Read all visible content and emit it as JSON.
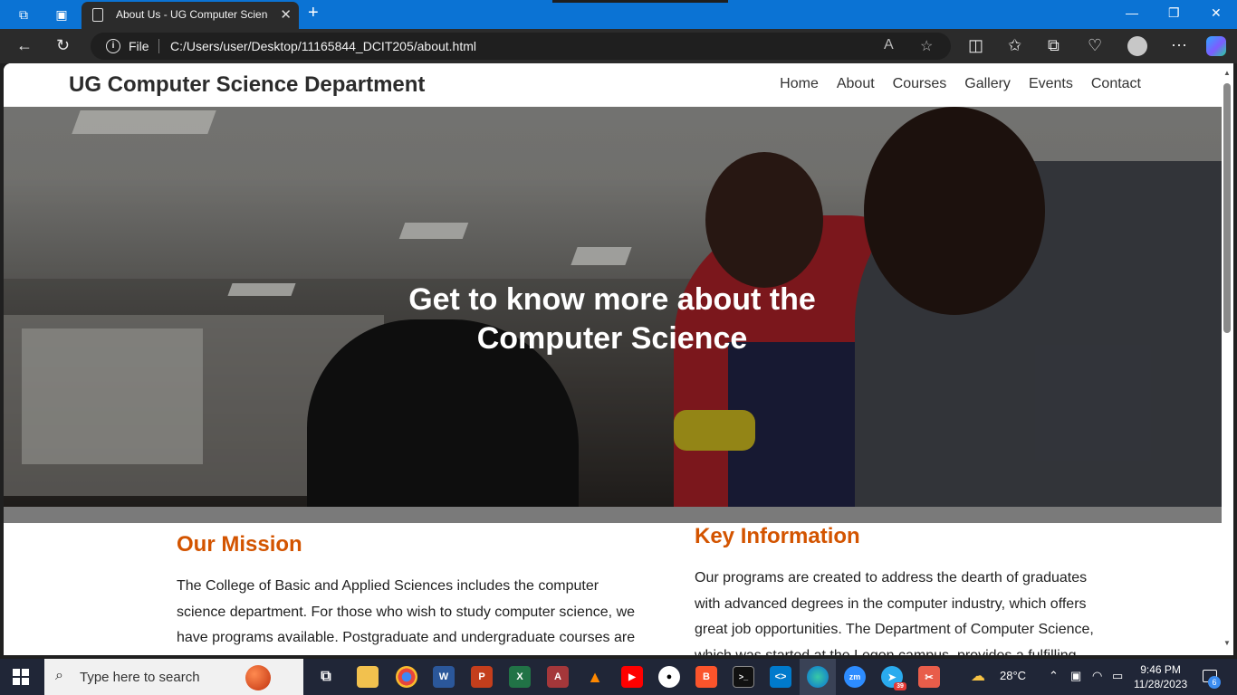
{
  "browser": {
    "tab_title": "About Us - UG Computer Science Department",
    "tab_close": "✕",
    "new_tab": "+",
    "address_scheme": "File",
    "address_url": "C:/Users/user/Desktop/11165844_DCIT205/about.html"
  },
  "site": {
    "title": "UG Computer Science Department",
    "nav": [
      "Home",
      "About",
      "Courses",
      "Gallery",
      "Events",
      "Contact"
    ],
    "hero_heading": "Get to know more about the Computer Science",
    "mission": {
      "heading": "Our Mission",
      "text": "The College of Basic and Applied Sciences includes the computer science department. For those who wish to study computer science, we have programs available. Postgraduate and undergraduate courses are offered."
    },
    "key_info": {
      "heading": "Key Information",
      "text": "Our programs are created to address the dearth of graduates with advanced degrees in the computer industry, which offers great job opportunities. The Department of Computer Science, which was started at the Legon campus, provides a fulfilling education."
    }
  },
  "taskbar": {
    "search_placeholder": "Type here to search",
    "weather": "28°C",
    "time": "9:46 PM",
    "date": "11/28/2023",
    "notification_count": "6",
    "telegram_badge": "39"
  },
  "colors": {
    "accent": "#d35400",
    "tab_strip": "#0b73d4",
    "taskbar": "#202637"
  }
}
